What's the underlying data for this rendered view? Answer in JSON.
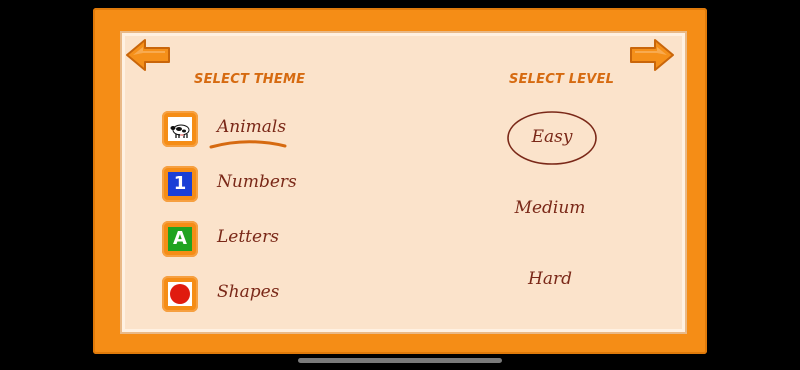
{
  "headings": {
    "theme": "SELECT THEME",
    "level": "SELECT LEVEL"
  },
  "themes": [
    {
      "label": "Animals",
      "icon": "cow-icon",
      "selected": true
    },
    {
      "label": "Numbers",
      "icon": "number-one-icon",
      "glyph": "1",
      "color": "#1a3fd6"
    },
    {
      "label": "Letters",
      "icon": "letter-a-icon",
      "glyph": "A",
      "color": "#1fa31f"
    },
    {
      "label": "Shapes",
      "icon": "red-circle-icon",
      "color": "#e01b0f"
    }
  ],
  "levels": [
    {
      "label": "Easy",
      "selected": true
    },
    {
      "label": "Medium"
    },
    {
      "label": "Hard"
    }
  ],
  "colors": {
    "frame": "#f58d16",
    "panel": "#fbe3cb",
    "heading": "#d66a10",
    "text": "#7a2818"
  }
}
